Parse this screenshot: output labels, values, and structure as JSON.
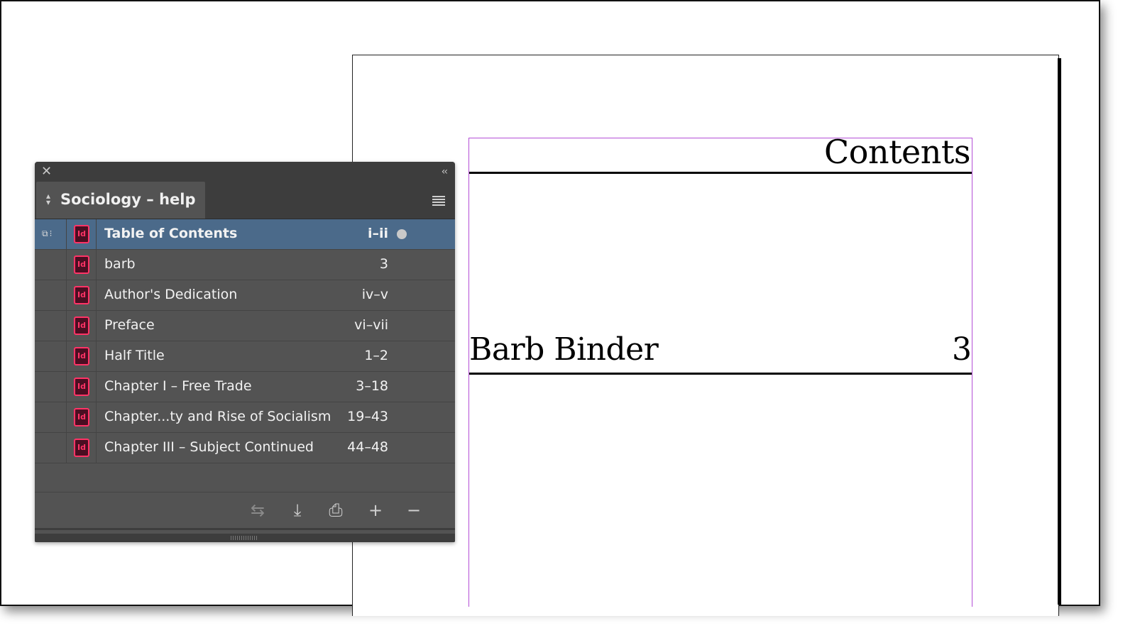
{
  "document": {
    "toc_heading": "Contents",
    "entry_title": "Barb Binder",
    "entry_page": "3"
  },
  "panel": {
    "book_title": "Sociology – help",
    "documents": [
      {
        "name": "Table of Contents",
        "pages": "i–ii",
        "selected": true,
        "open": true
      },
      {
        "name": "barb",
        "pages": "3"
      },
      {
        "name": "Author's Dedication",
        "pages": "iv–v"
      },
      {
        "name": "Preface",
        "pages": "vi–vii"
      },
      {
        "name": "Half Title",
        "pages": "1–2"
      },
      {
        "name": "Chapter I – Free Trade",
        "pages": "3–18"
      },
      {
        "name": "Chapter...ty and Rise of Socialism",
        "pages": "19–43"
      },
      {
        "name": "Chapter III – Subject Continued",
        "pages": "44–48"
      }
    ],
    "icons": {
      "close": "✕",
      "collapse": "‹‹",
      "doc_icon_label": "Id",
      "sync_style": "⧉⁝",
      "footer": {
        "synchronize": "⇆",
        "save_book": "⤓",
        "print_book": "⎙",
        "add_document": "+",
        "remove_document": "−"
      }
    },
    "colors": {
      "panel_bg": "#535353",
      "selected_row": "#4b6a8a",
      "indesign_pink": "#ff3366"
    }
  }
}
